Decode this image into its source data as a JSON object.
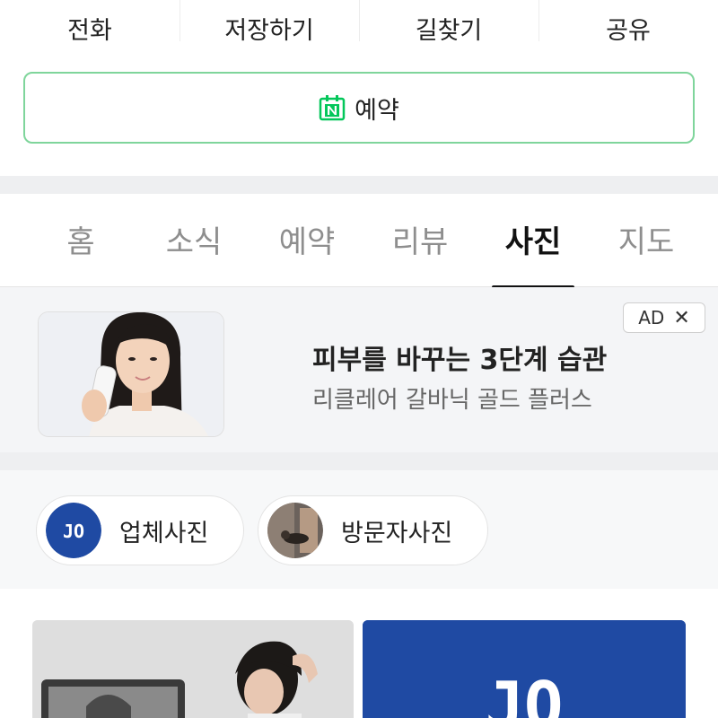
{
  "actions": {
    "call": "전화",
    "save": "저장하기",
    "directions": "길찾기",
    "share": "공유"
  },
  "booking": {
    "label": "예약",
    "icon": "naver-calendar-icon",
    "border_color": "#7fd59b",
    "icon_color": "#03c75a"
  },
  "tabs": [
    {
      "label": "홈",
      "active": false
    },
    {
      "label": "소식",
      "active": false
    },
    {
      "label": "예약",
      "active": false
    },
    {
      "label": "리뷰",
      "active": false
    },
    {
      "label": "사진",
      "active": true
    },
    {
      "label": "지도",
      "active": false
    }
  ],
  "ad": {
    "badge": "AD",
    "close_icon": "close-icon",
    "title": "피부를 바꾸는 3단계 습관",
    "subtitle": "리클레어 갈바닉 골드 플러스"
  },
  "photo_filters": [
    {
      "label": "업체사진",
      "avatar_text": "JO"
    },
    {
      "label": "방문자사진"
    }
  ],
  "photos": [
    {
      "alt": "업체 사진 1"
    },
    {
      "alt": "업체 사진 2",
      "logo_text": "JO"
    }
  ],
  "colors": {
    "brand_green": "#03c75a",
    "logo_blue": "#1f4aa3",
    "section_gap": "#eeeff1"
  }
}
